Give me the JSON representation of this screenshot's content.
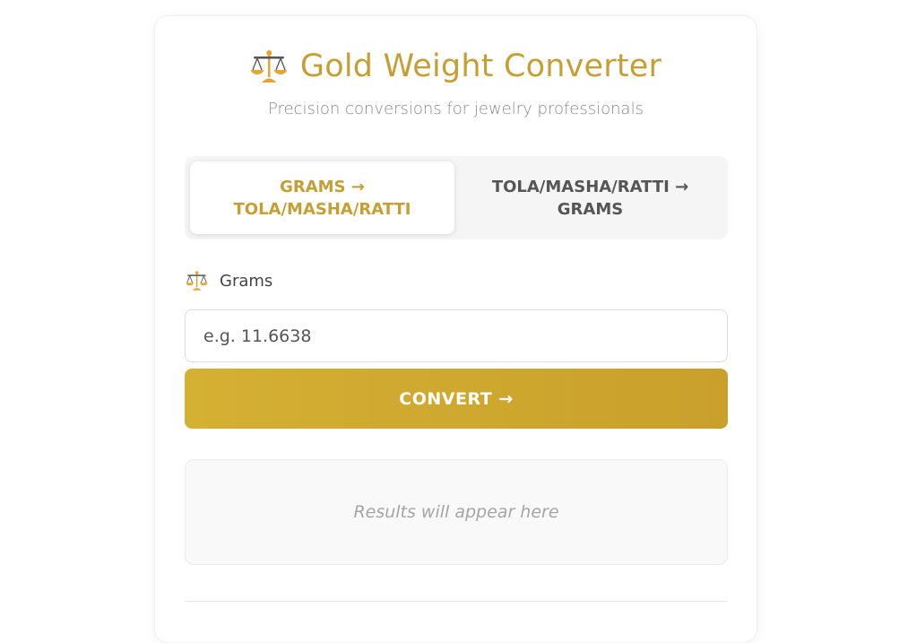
{
  "header": {
    "title": "Gold Weight Converter",
    "subtitle": "Precision conversions for jewelry professionals",
    "icon": "balance-scale-icon"
  },
  "tabs": [
    {
      "label": "GRAMS → TOLA/MASHA/RATTI",
      "active": true
    },
    {
      "label": "TOLA/MASHA/RATTI → GRAMS",
      "active": false
    }
  ],
  "form": {
    "input_label": "Grams",
    "input_icon": "balance-scale-icon",
    "input_placeholder": "e.g. 11.6638",
    "input_value": "",
    "convert_label": "CONVERT →"
  },
  "results": {
    "placeholder": "Results will appear here"
  },
  "colors": {
    "accent": "#c4a034",
    "button": "#cca82f",
    "text": "#444444",
    "muted": "#8a8a8a"
  }
}
